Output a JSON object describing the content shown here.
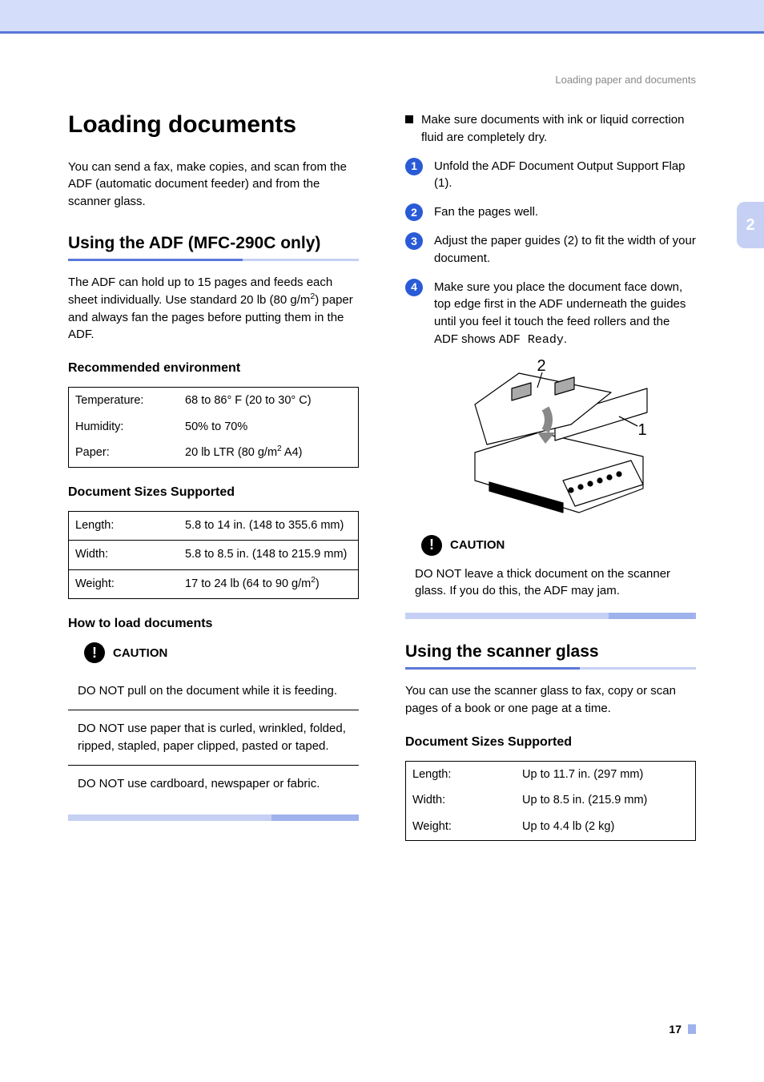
{
  "breadcrumb": "Loading paper and documents",
  "sidetab": "2",
  "page_number": "17",
  "left": {
    "h1": "Loading documents",
    "intro": "You can send a fax, make copies, and scan from the ADF (automatic document feeder) and from the scanner glass.",
    "h2_adf": "Using the ADF (MFC-290C only)",
    "adf_p_a": "The ADF can hold up to 15 pages and feeds each sheet individually. Use standard 20 lb (80 g/m",
    "adf_p_b": ") paper and always fan the pages before putting them in the ADF.",
    "h3_env": "Recommended environment",
    "env": {
      "r1k": "Temperature:",
      "r1v": "68 to 86° F (20 to 30° C)",
      "r2k": "Humidity:",
      "r2v": "50% to 70%",
      "r3k": "Paper:",
      "r3v_a": "20 lb LTR (80 g/m",
      "r3v_b": "  A4)"
    },
    "h3_sizes": "Document Sizes Supported",
    "sizes": {
      "r1k": "Length:",
      "r1v": "5.8 to 14 in. (148 to 355.6 mm)",
      "r2k": "Width:",
      "r2v": "5.8 to 8.5 in. (148 to 215.9 mm)",
      "r3k": "Weight:",
      "r3v_a": "17 to 24 lb (64 to 90 g/m",
      "r3v_b": ")"
    },
    "h3_how": "How to load documents",
    "caution_label": "CAUTION",
    "caution1": "DO NOT pull on the document while it is feeding.",
    "caution2": "DO NOT use paper that is curled, wrinkled, folded, ripped, stapled, paper clipped, pasted or taped.",
    "caution3": "DO NOT use cardboard, newspaper or fabric."
  },
  "right": {
    "bullet1": "Make sure documents with ink or liquid correction fluid are completely dry.",
    "step1": "Unfold the ADF Document Output Support Flap (1).",
    "step2": "Fan the pages well.",
    "step3": "Adjust the paper guides (2) to fit the width of your document.",
    "step4_a": "Make sure you place the document face down, top edge first in the ADF underneath the guides until you feel it touch the feed rollers and the ADF shows ",
    "step4_b": "ADF Ready",
    "step4_c": ".",
    "callout1": "1",
    "callout2": "2",
    "caution_label": "CAUTION",
    "caution_scanner": "DO NOT leave a thick document on the scanner glass. If you do this, the ADF may jam.",
    "h2_scanner": "Using the scanner glass",
    "scanner_p": "You can use the scanner glass to fax, copy or scan pages of a book or one page at a time.",
    "h3_sizes": "Document Sizes Supported",
    "glass": {
      "r1k": "Length:",
      "r1v": "Up to 11.7 in. (297 mm)",
      "r2k": "Width:",
      "r2v": "Up to 8.5 in. (215.9 mm)",
      "r3k": "Weight:",
      "r3v": "Up to 4.4 lb (2 kg)"
    }
  }
}
